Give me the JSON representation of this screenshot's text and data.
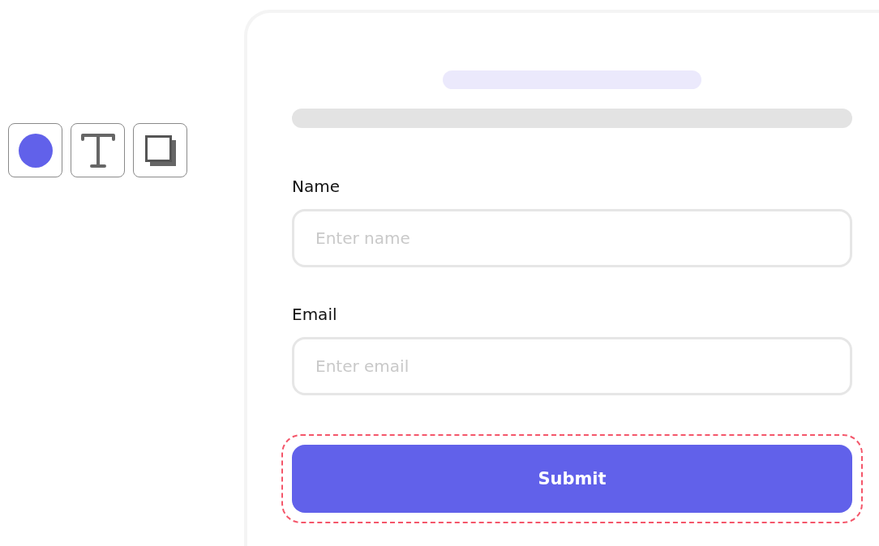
{
  "tools": [
    {
      "kind": "circle"
    },
    {
      "kind": "text"
    },
    {
      "kind": "frame"
    }
  ],
  "form": {
    "fields": [
      {
        "label": "Name",
        "placeholder": "Enter name"
      },
      {
        "label": "Email",
        "placeholder": "Enter email"
      }
    ],
    "submit": {
      "label": "Submit",
      "selected": true
    }
  }
}
